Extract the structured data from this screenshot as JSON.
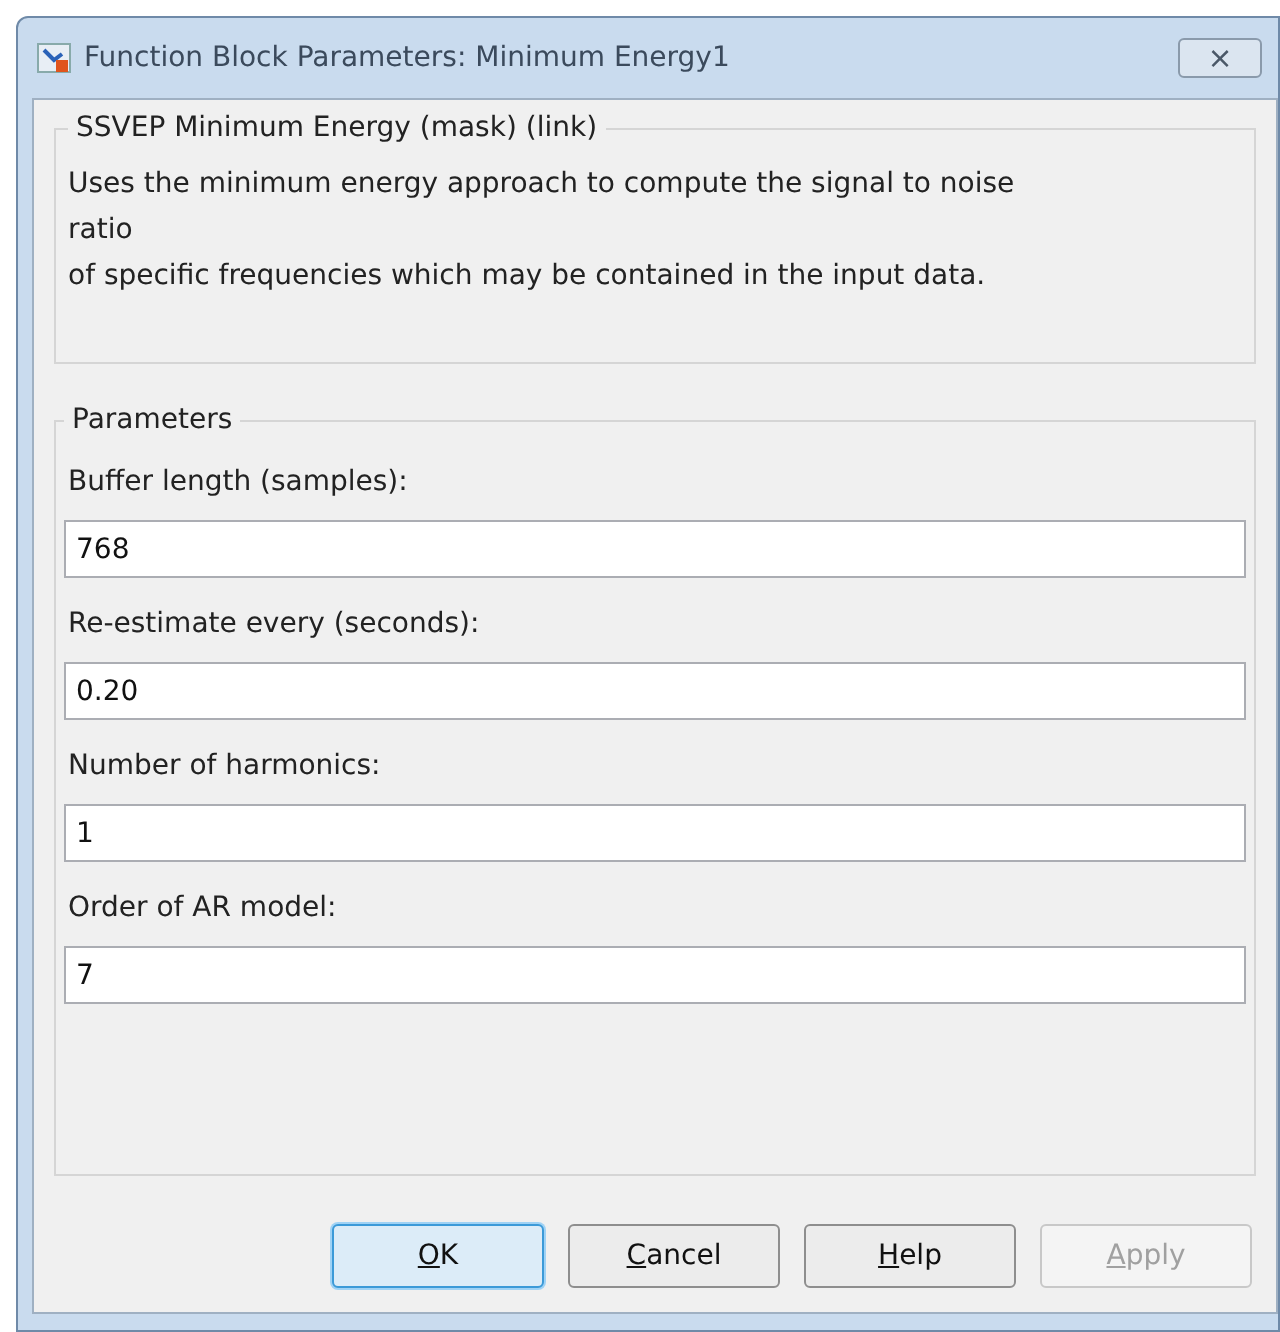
{
  "window": {
    "title": "Function Block Parameters: Minimum Energy1",
    "close": "×"
  },
  "description": {
    "title": "SSVEP Minimum Energy (mask) (link)",
    "lines": [
      "Uses the minimum energy approach to compute the signal to noise",
      "ratio",
      "of specific frequencies which may be contained in the input data."
    ]
  },
  "parameters": {
    "title": "Parameters",
    "fields": [
      {
        "label": "Buffer length (samples):",
        "value": "768"
      },
      {
        "label": "Re-estimate every (seconds):",
        "value": "0.20"
      },
      {
        "label": "Number of harmonics:",
        "value": "1"
      },
      {
        "label": "Order of AR model:",
        "value": "7"
      }
    ]
  },
  "buttons": [
    {
      "access_key": "O",
      "rest": "K",
      "default": true,
      "disabled": false
    },
    {
      "access_key": "C",
      "rest": "ancel",
      "default": false,
      "disabled": false
    },
    {
      "access_key": "H",
      "rest": "elp",
      "default": false,
      "disabled": false
    },
    {
      "access_key": "A",
      "rest": "pply",
      "default": false,
      "disabled": true
    }
  ]
}
